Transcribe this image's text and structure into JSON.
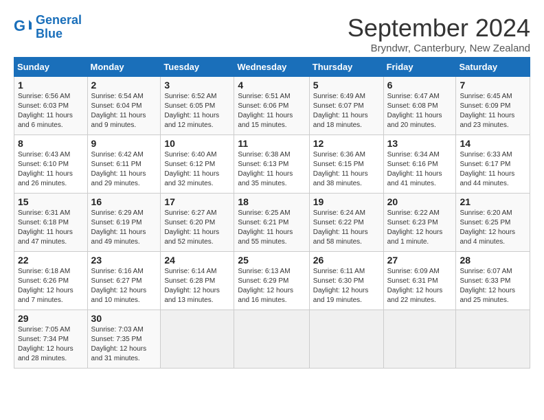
{
  "logo": {
    "line1": "General",
    "line2": "Blue"
  },
  "title": "September 2024",
  "subtitle": "Bryndwr, Canterbury, New Zealand",
  "days_header": [
    "Sunday",
    "Monday",
    "Tuesday",
    "Wednesday",
    "Thursday",
    "Friday",
    "Saturday"
  ],
  "weeks": [
    [
      {
        "day": "1",
        "sunrise": "6:56 AM",
        "sunset": "6:03 PM",
        "daylight": "11 hours and 6 minutes."
      },
      {
        "day": "2",
        "sunrise": "6:54 AM",
        "sunset": "6:04 PM",
        "daylight": "11 hours and 9 minutes."
      },
      {
        "day": "3",
        "sunrise": "6:52 AM",
        "sunset": "6:05 PM",
        "daylight": "11 hours and 12 minutes."
      },
      {
        "day": "4",
        "sunrise": "6:51 AM",
        "sunset": "6:06 PM",
        "daylight": "11 hours and 15 minutes."
      },
      {
        "day": "5",
        "sunrise": "6:49 AM",
        "sunset": "6:07 PM",
        "daylight": "11 hours and 18 minutes."
      },
      {
        "day": "6",
        "sunrise": "6:47 AM",
        "sunset": "6:08 PM",
        "daylight": "11 hours and 20 minutes."
      },
      {
        "day": "7",
        "sunrise": "6:45 AM",
        "sunset": "6:09 PM",
        "daylight": "11 hours and 23 minutes."
      }
    ],
    [
      {
        "day": "8",
        "sunrise": "6:43 AM",
        "sunset": "6:10 PM",
        "daylight": "11 hours and 26 minutes."
      },
      {
        "day": "9",
        "sunrise": "6:42 AM",
        "sunset": "6:11 PM",
        "daylight": "11 hours and 29 minutes."
      },
      {
        "day": "10",
        "sunrise": "6:40 AM",
        "sunset": "6:12 PM",
        "daylight": "11 hours and 32 minutes."
      },
      {
        "day": "11",
        "sunrise": "6:38 AM",
        "sunset": "6:13 PM",
        "daylight": "11 hours and 35 minutes."
      },
      {
        "day": "12",
        "sunrise": "6:36 AM",
        "sunset": "6:15 PM",
        "daylight": "11 hours and 38 minutes."
      },
      {
        "day": "13",
        "sunrise": "6:34 AM",
        "sunset": "6:16 PM",
        "daylight": "11 hours and 41 minutes."
      },
      {
        "day": "14",
        "sunrise": "6:33 AM",
        "sunset": "6:17 PM",
        "daylight": "11 hours and 44 minutes."
      }
    ],
    [
      {
        "day": "15",
        "sunrise": "6:31 AM",
        "sunset": "6:18 PM",
        "daylight": "11 hours and 47 minutes."
      },
      {
        "day": "16",
        "sunrise": "6:29 AM",
        "sunset": "6:19 PM",
        "daylight": "11 hours and 49 minutes."
      },
      {
        "day": "17",
        "sunrise": "6:27 AM",
        "sunset": "6:20 PM",
        "daylight": "11 hours and 52 minutes."
      },
      {
        "day": "18",
        "sunrise": "6:25 AM",
        "sunset": "6:21 PM",
        "daylight": "11 hours and 55 minutes."
      },
      {
        "day": "19",
        "sunrise": "6:24 AM",
        "sunset": "6:22 PM",
        "daylight": "11 hours and 58 minutes."
      },
      {
        "day": "20",
        "sunrise": "6:22 AM",
        "sunset": "6:23 PM",
        "daylight": "12 hours and 1 minute."
      },
      {
        "day": "21",
        "sunrise": "6:20 AM",
        "sunset": "6:25 PM",
        "daylight": "12 hours and 4 minutes."
      }
    ],
    [
      {
        "day": "22",
        "sunrise": "6:18 AM",
        "sunset": "6:26 PM",
        "daylight": "12 hours and 7 minutes."
      },
      {
        "day": "23",
        "sunrise": "6:16 AM",
        "sunset": "6:27 PM",
        "daylight": "12 hours and 10 minutes."
      },
      {
        "day": "24",
        "sunrise": "6:14 AM",
        "sunset": "6:28 PM",
        "daylight": "12 hours and 13 minutes."
      },
      {
        "day": "25",
        "sunrise": "6:13 AM",
        "sunset": "6:29 PM",
        "daylight": "12 hours and 16 minutes."
      },
      {
        "day": "26",
        "sunrise": "6:11 AM",
        "sunset": "6:30 PM",
        "daylight": "12 hours and 19 minutes."
      },
      {
        "day": "27",
        "sunrise": "6:09 AM",
        "sunset": "6:31 PM",
        "daylight": "12 hours and 22 minutes."
      },
      {
        "day": "28",
        "sunrise": "6:07 AM",
        "sunset": "6:33 PM",
        "daylight": "12 hours and 25 minutes."
      }
    ],
    [
      {
        "day": "29",
        "sunrise": "7:05 AM",
        "sunset": "7:34 PM",
        "daylight": "12 hours and 28 minutes."
      },
      {
        "day": "30",
        "sunrise": "7:03 AM",
        "sunset": "7:35 PM",
        "daylight": "12 hours and 31 minutes."
      },
      null,
      null,
      null,
      null,
      null
    ]
  ]
}
